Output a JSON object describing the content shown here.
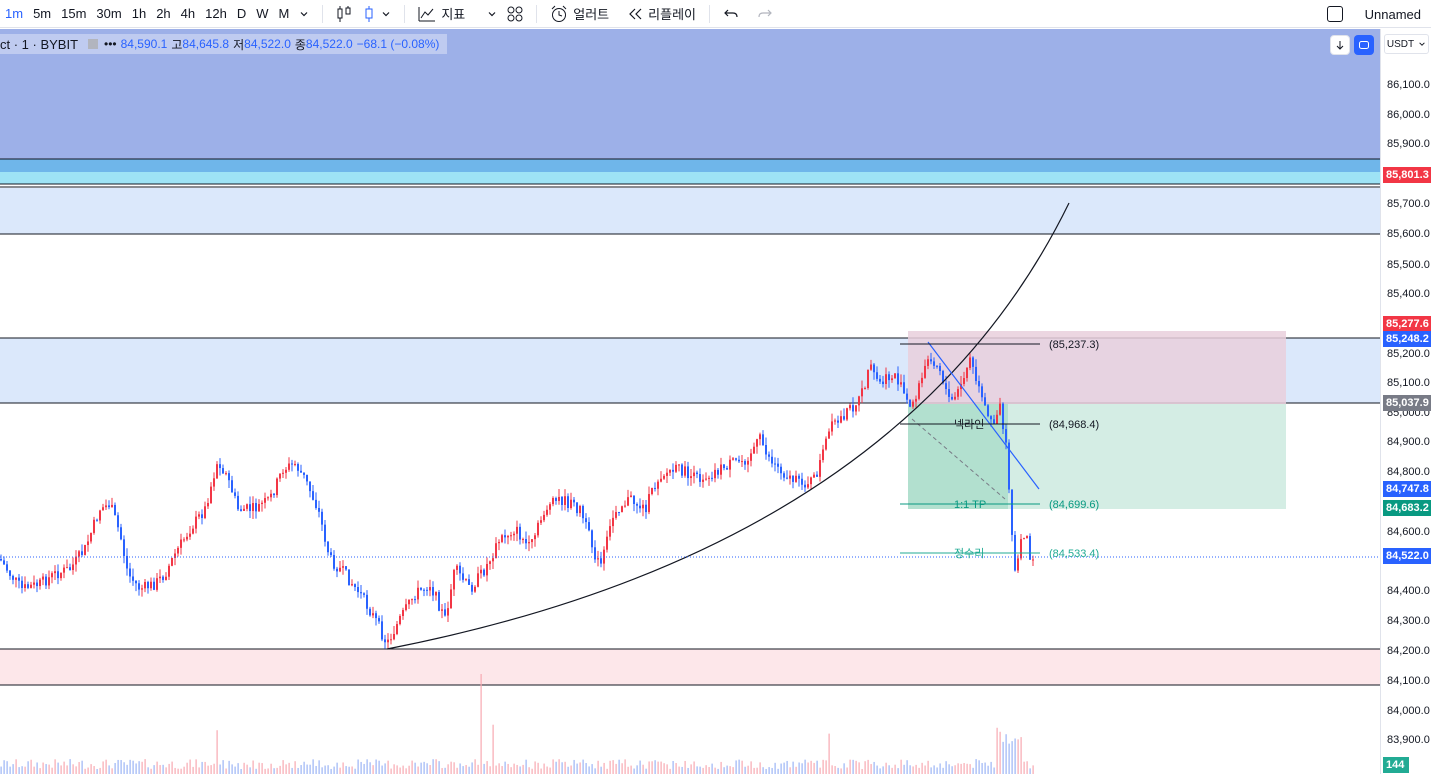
{
  "toolbar": {
    "timeframes": [
      "1m",
      "5m",
      "15m",
      "30m",
      "1h",
      "2h",
      "4h",
      "12h",
      "D",
      "W",
      "M"
    ],
    "active_timeframe": "1m",
    "indicators_label": "지표",
    "alert_label": "얼러트",
    "replay_label": "리플레이",
    "layout_name": "Unnamed"
  },
  "legend": {
    "symbol": "ct · 1 · BYBIT",
    "bid": "84,590.1",
    "open_label": "고",
    "open": "84,645.8",
    "low_label": "저",
    "low": "84,522.0",
    "close_label": "종",
    "close": "84,522.0",
    "change": "−68.1 (−0.08%)"
  },
  "price_scale": {
    "currency": "USDT",
    "ticks": [
      "86,100.0",
      "86,000.0",
      "85,900.0",
      "85,700.0",
      "85,600.0",
      "85,500.0",
      "85,400.0",
      "85,200.0",
      "85,100.0",
      "85,000.0",
      "84,900.0",
      "84,800.0",
      "84,600.0",
      "84,400.0",
      "84,300.0",
      "84,200.0",
      "84,100.0",
      "84,000.0",
      "83,900.0"
    ],
    "labels": {
      "l1": {
        "text": "85,801.3",
        "color": "#f23645"
      },
      "l2": {
        "text": "85,277.6",
        "color": "#f23645"
      },
      "l3": {
        "text": "85,248.2",
        "color": "#2962ff"
      },
      "l4": {
        "text": "85,037.9",
        "color": "#787b86"
      },
      "l5": {
        "text": "84,747.8",
        "color": "#2962ff"
      },
      "l6": {
        "text": "84,683.2",
        "color": "#089981"
      },
      "l7": {
        "text": "84,522.0",
        "color": "#2962ff"
      },
      "l8": {
        "text": "144",
        "color": "#22ab94"
      }
    }
  },
  "annotations": {
    "level_top": "(85,237.3)",
    "neckline_label": "넥라인",
    "neckline_value": "(84,968.4)",
    "tp_label": "1:1 TP",
    "tp_value": "(84,699.6)",
    "correction_label": "정수리",
    "correction_value": "(84,533.4)"
  },
  "colors": {
    "up": "#f23645",
    "down": "#2962ff",
    "accent": "#2962ff"
  }
}
